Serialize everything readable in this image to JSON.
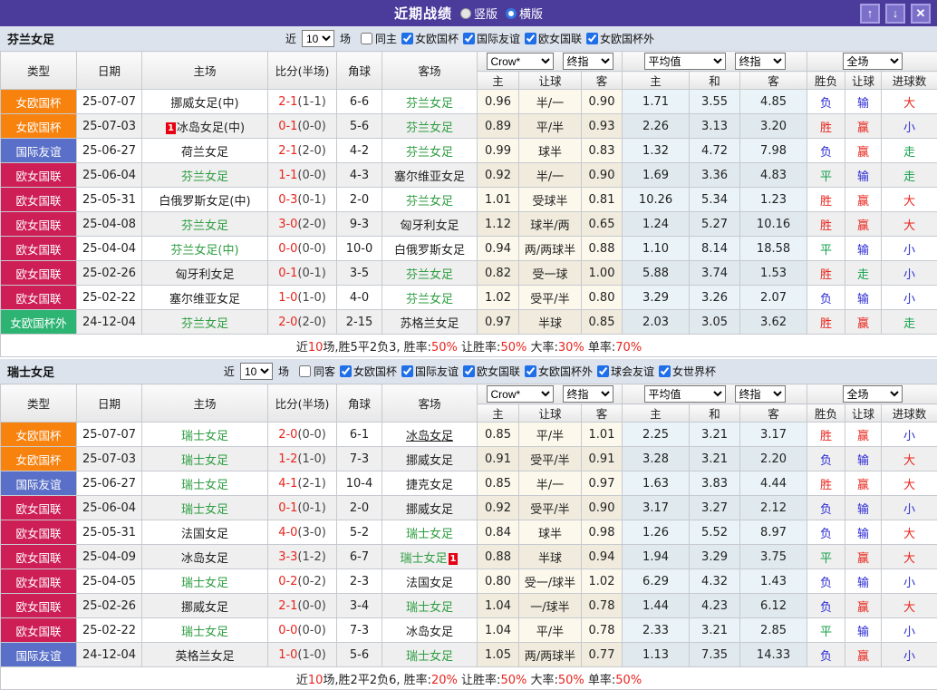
{
  "titlebar": {
    "title": "近期战绩",
    "vertical": {
      "label": "竖版",
      "selected": false
    },
    "horizontal": {
      "label": "横版",
      "selected": true
    },
    "up_icon": "↑",
    "down_icon": "↓",
    "close_icon": "✕"
  },
  "league_colors": {
    "女欧国杯": "#f8820e",
    "国际友谊": "#5a70c8",
    "欧女国联": "#cd1e55",
    "女欧国杯外": "#2db473"
  },
  "value_colors": {
    "r": "#e8251d",
    "b": "#2b2bd5",
    "g": "#13a04a"
  },
  "table_header": {
    "type": "类型",
    "date": "日期",
    "home": "主场",
    "score": "比分(半场)",
    "corner": "角球",
    "away": "客场",
    "crow_select": "Crow*",
    "final_select": "终指",
    "avg_select": "平均值",
    "full_select": "全场",
    "home_odds": "主",
    "handicap": "让球",
    "away_odds": "客",
    "avg_home": "主",
    "avg_draw": "和",
    "avg_away": "客",
    "result": "胜负",
    "handicap_result": "让球",
    "goals": "进球数"
  },
  "sections": [
    {
      "team": "芬兰女足",
      "filter": {
        "near": "近",
        "count": "10",
        "games": "场",
        "same": "同主",
        "leagues": [
          "女欧国杯",
          "国际友谊",
          "欧女国联",
          "女欧国杯外"
        ]
      },
      "rows": [
        {
          "league": "女欧国杯",
          "date": "25-07-07",
          "home": {
            "t": "挪威女足(中)"
          },
          "score": "2-1",
          "half": "(1-1)",
          "corner": "6-6",
          "away": {
            "t": "芬兰女足",
            "g": 1
          },
          "odds": [
            "0.96",
            "半/一",
            "0.90"
          ],
          "avg": [
            "1.71",
            "3.55",
            "4.85"
          ],
          "res": [
            [
              "负",
              "b"
            ],
            [
              "输",
              "b"
            ],
            [
              "大",
              "r"
            ]
          ]
        },
        {
          "league": "女欧国杯",
          "date": "25-07-03",
          "home": {
            "t": "冰岛女足(中)",
            "rc": "1",
            "rcpos": "pre"
          },
          "score": "0-1",
          "half": "(0-0)",
          "corner": "5-6",
          "away": {
            "t": "芬兰女足",
            "g": 1
          },
          "odds": [
            "0.89",
            "平/半",
            "0.93"
          ],
          "avg": [
            "2.26",
            "3.13",
            "3.20"
          ],
          "res": [
            [
              "胜",
              "r"
            ],
            [
              "赢",
              "r"
            ],
            [
              "小",
              "b"
            ]
          ]
        },
        {
          "league": "国际友谊",
          "date": "25-06-27",
          "home": {
            "t": "荷兰女足"
          },
          "score": "2-1",
          "half": "(2-0)",
          "corner": "4-2",
          "away": {
            "t": "芬兰女足",
            "g": 1
          },
          "odds": [
            "0.99",
            "球半",
            "0.83"
          ],
          "avg": [
            "1.32",
            "4.72",
            "7.98"
          ],
          "res": [
            [
              "负",
              "b"
            ],
            [
              "赢",
              "r"
            ],
            [
              "走",
              "g"
            ]
          ]
        },
        {
          "league": "欧女国联",
          "date": "25-06-04",
          "home": {
            "t": "芬兰女足",
            "g": 1
          },
          "score": "1-1",
          "half": "(0-0)",
          "corner": "4-3",
          "away": {
            "t": "塞尔维亚女足"
          },
          "odds": [
            "0.92",
            "半/一",
            "0.90"
          ],
          "avg": [
            "1.69",
            "3.36",
            "4.83"
          ],
          "res": [
            [
              "平",
              "g"
            ],
            [
              "输",
              "b"
            ],
            [
              "走",
              "g"
            ]
          ]
        },
        {
          "league": "欧女国联",
          "date": "25-05-31",
          "home": {
            "t": "白俄罗斯女足(中)"
          },
          "score": "0-3",
          "half": "(0-1)",
          "corner": "2-0",
          "away": {
            "t": "芬兰女足",
            "g": 1
          },
          "odds": [
            "1.01",
            "受球半",
            "0.81"
          ],
          "avg": [
            "10.26",
            "5.34",
            "1.23"
          ],
          "res": [
            [
              "胜",
              "r"
            ],
            [
              "赢",
              "r"
            ],
            [
              "大",
              "r"
            ]
          ]
        },
        {
          "league": "欧女国联",
          "date": "25-04-08",
          "home": {
            "t": "芬兰女足",
            "g": 1
          },
          "score": "3-0",
          "half": "(2-0)",
          "corner": "9-3",
          "away": {
            "t": "匈牙利女足"
          },
          "odds": [
            "1.12",
            "球半/两",
            "0.65"
          ],
          "avg": [
            "1.24",
            "5.27",
            "10.16"
          ],
          "res": [
            [
              "胜",
              "r"
            ],
            [
              "赢",
              "r"
            ],
            [
              "大",
              "r"
            ]
          ]
        },
        {
          "league": "欧女国联",
          "date": "25-04-04",
          "home": {
            "t": "芬兰女足(中)",
            "g": 1
          },
          "score": "0-0",
          "half": "(0-0)",
          "corner": "10-0",
          "away": {
            "t": "白俄罗斯女足"
          },
          "odds": [
            "0.94",
            "两/两球半",
            "0.88"
          ],
          "avg": [
            "1.10",
            "8.14",
            "18.58"
          ],
          "res": [
            [
              "平",
              "g"
            ],
            [
              "输",
              "b"
            ],
            [
              "小",
              "b"
            ]
          ]
        },
        {
          "league": "欧女国联",
          "date": "25-02-26",
          "home": {
            "t": "匈牙利女足"
          },
          "score": "0-1",
          "half": "(0-1)",
          "corner": "3-5",
          "away": {
            "t": "芬兰女足",
            "g": 1
          },
          "odds": [
            "0.82",
            "受一球",
            "1.00"
          ],
          "avg": [
            "5.88",
            "3.74",
            "1.53"
          ],
          "res": [
            [
              "胜",
              "r"
            ],
            [
              "走",
              "g"
            ],
            [
              "小",
              "b"
            ]
          ]
        },
        {
          "league": "欧女国联",
          "date": "25-02-22",
          "home": {
            "t": "塞尔维亚女足"
          },
          "score": "1-0",
          "half": "(1-0)",
          "corner": "4-0",
          "away": {
            "t": "芬兰女足",
            "g": 1
          },
          "odds": [
            "1.02",
            "受平/半",
            "0.80"
          ],
          "avg": [
            "3.29",
            "3.26",
            "2.07"
          ],
          "res": [
            [
              "负",
              "b"
            ],
            [
              "输",
              "b"
            ],
            [
              "小",
              "b"
            ]
          ]
        },
        {
          "league": "女欧国杯外",
          "date": "24-12-04",
          "home": {
            "t": "芬兰女足",
            "g": 1
          },
          "score": "2-0",
          "half": "(2-0)",
          "corner": "2-15",
          "away": {
            "t": "苏格兰女足"
          },
          "odds": [
            "0.97",
            "半球",
            "0.85"
          ],
          "avg": [
            "2.03",
            "3.05",
            "3.62"
          ],
          "res": [
            [
              "胜",
              "r"
            ],
            [
              "赢",
              "r"
            ],
            [
              "走",
              "g"
            ]
          ]
        }
      ],
      "summary": [
        [
          "近",
          0
        ],
        [
          "10",
          1
        ],
        [
          "场,胜5平2负3, 胜率:",
          0
        ],
        [
          "50%",
          1
        ],
        [
          " 让胜率:",
          0
        ],
        [
          "50%",
          1
        ],
        [
          " 大率:",
          0
        ],
        [
          "30%",
          1
        ],
        [
          " 单率:",
          0
        ],
        [
          "70%",
          1
        ]
      ]
    },
    {
      "team": "瑞士女足",
      "filter": {
        "near": "近",
        "count": "10",
        "games": "场",
        "same": "同客",
        "leagues": [
          "女欧国杯",
          "国际友谊",
          "欧女国联",
          "女欧国杯外",
          "球会友谊",
          "女世界杯"
        ]
      },
      "rows": [
        {
          "league": "女欧国杯",
          "date": "25-07-07",
          "home": {
            "t": "瑞士女足",
            "g": 1
          },
          "score": "2-0",
          "half": "(0-0)",
          "corner": "6-1",
          "away": {
            "t": "冰岛女足",
            "u": 1
          },
          "odds": [
            "0.85",
            "平/半",
            "1.01"
          ],
          "avg": [
            "2.25",
            "3.21",
            "3.17"
          ],
          "res": [
            [
              "胜",
              "r"
            ],
            [
              "赢",
              "r"
            ],
            [
              "小",
              "b"
            ]
          ]
        },
        {
          "league": "女欧国杯",
          "date": "25-07-03",
          "home": {
            "t": "瑞士女足",
            "g": 1
          },
          "score": "1-2",
          "half": "(1-0)",
          "corner": "7-3",
          "away": {
            "t": "挪威女足"
          },
          "odds": [
            "0.91",
            "受平/半",
            "0.91"
          ],
          "avg": [
            "3.28",
            "3.21",
            "2.20"
          ],
          "res": [
            [
              "负",
              "b"
            ],
            [
              "输",
              "b"
            ],
            [
              "大",
              "r"
            ]
          ]
        },
        {
          "league": "国际友谊",
          "date": "25-06-27",
          "home": {
            "t": "瑞士女足",
            "g": 1
          },
          "score": "4-1",
          "half": "(2-1)",
          "corner": "10-4",
          "away": {
            "t": "捷克女足"
          },
          "odds": [
            "0.85",
            "半/一",
            "0.97"
          ],
          "avg": [
            "1.63",
            "3.83",
            "4.44"
          ],
          "res": [
            [
              "胜",
              "r"
            ],
            [
              "赢",
              "r"
            ],
            [
              "大",
              "r"
            ]
          ]
        },
        {
          "league": "欧女国联",
          "date": "25-06-04",
          "home": {
            "t": "瑞士女足",
            "g": 1
          },
          "score": "0-1",
          "half": "(0-1)",
          "corner": "2-0",
          "away": {
            "t": "挪威女足"
          },
          "odds": [
            "0.92",
            "受平/半",
            "0.90"
          ],
          "avg": [
            "3.17",
            "3.27",
            "2.12"
          ],
          "res": [
            [
              "负",
              "b"
            ],
            [
              "输",
              "b"
            ],
            [
              "小",
              "b"
            ]
          ]
        },
        {
          "league": "欧女国联",
          "date": "25-05-31",
          "home": {
            "t": "法国女足"
          },
          "score": "4-0",
          "half": "(3-0)",
          "corner": "5-2",
          "away": {
            "t": "瑞士女足",
            "g": 1
          },
          "odds": [
            "0.84",
            "球半",
            "0.98"
          ],
          "avg": [
            "1.26",
            "5.52",
            "8.97"
          ],
          "res": [
            [
              "负",
              "b"
            ],
            [
              "输",
              "b"
            ],
            [
              "大",
              "r"
            ]
          ]
        },
        {
          "league": "欧女国联",
          "date": "25-04-09",
          "home": {
            "t": "冰岛女足"
          },
          "score": "3-3",
          "half": "(1-2)",
          "corner": "6-7",
          "away": {
            "t": "瑞士女足",
            "g": 1,
            "rc": "1",
            "rcpos": "post"
          },
          "odds": [
            "0.88",
            "半球",
            "0.94"
          ],
          "avg": [
            "1.94",
            "3.29",
            "3.75"
          ],
          "res": [
            [
              "平",
              "g"
            ],
            [
              "赢",
              "r"
            ],
            [
              "大",
              "r"
            ]
          ]
        },
        {
          "league": "欧女国联",
          "date": "25-04-05",
          "home": {
            "t": "瑞士女足",
            "g": 1
          },
          "score": "0-2",
          "half": "(0-2)",
          "corner": "2-3",
          "away": {
            "t": "法国女足"
          },
          "odds": [
            "0.80",
            "受一/球半",
            "1.02"
          ],
          "avg": [
            "6.29",
            "4.32",
            "1.43"
          ],
          "res": [
            [
              "负",
              "b"
            ],
            [
              "输",
              "b"
            ],
            [
              "小",
              "b"
            ]
          ]
        },
        {
          "league": "欧女国联",
          "date": "25-02-26",
          "home": {
            "t": "挪威女足"
          },
          "score": "2-1",
          "half": "(0-0)",
          "corner": "3-4",
          "away": {
            "t": "瑞士女足",
            "g": 1
          },
          "odds": [
            "1.04",
            "一/球半",
            "0.78"
          ],
          "avg": [
            "1.44",
            "4.23",
            "6.12"
          ],
          "res": [
            [
              "负",
              "b"
            ],
            [
              "赢",
              "r"
            ],
            [
              "大",
              "r"
            ]
          ]
        },
        {
          "league": "欧女国联",
          "date": "25-02-22",
          "home": {
            "t": "瑞士女足",
            "g": 1
          },
          "score": "0-0",
          "half": "(0-0)",
          "corner": "7-3",
          "away": {
            "t": "冰岛女足"
          },
          "odds": [
            "1.04",
            "平/半",
            "0.78"
          ],
          "avg": [
            "2.33",
            "3.21",
            "2.85"
          ],
          "res": [
            [
              "平",
              "g"
            ],
            [
              "输",
              "b"
            ],
            [
              "小",
              "b"
            ]
          ]
        },
        {
          "league": "国际友谊",
          "date": "24-12-04",
          "home": {
            "t": "英格兰女足"
          },
          "score": "1-0",
          "half": "(1-0)",
          "corner": "5-6",
          "away": {
            "t": "瑞士女足",
            "g": 1
          },
          "odds": [
            "1.05",
            "两/两球半",
            "0.77"
          ],
          "avg": [
            "1.13",
            "7.35",
            "14.33"
          ],
          "res": [
            [
              "负",
              "b"
            ],
            [
              "赢",
              "r"
            ],
            [
              "小",
              "b"
            ]
          ]
        }
      ],
      "summary": [
        [
          "近",
          0
        ],
        [
          "10",
          1
        ],
        [
          "场,胜2平2负6, 胜率:",
          0
        ],
        [
          "20%",
          1
        ],
        [
          " 让胜率:",
          0
        ],
        [
          "50%",
          1
        ],
        [
          " 大率:",
          0
        ],
        [
          "50%",
          1
        ],
        [
          " 单率:",
          0
        ],
        [
          "50%",
          1
        ]
      ]
    }
  ]
}
